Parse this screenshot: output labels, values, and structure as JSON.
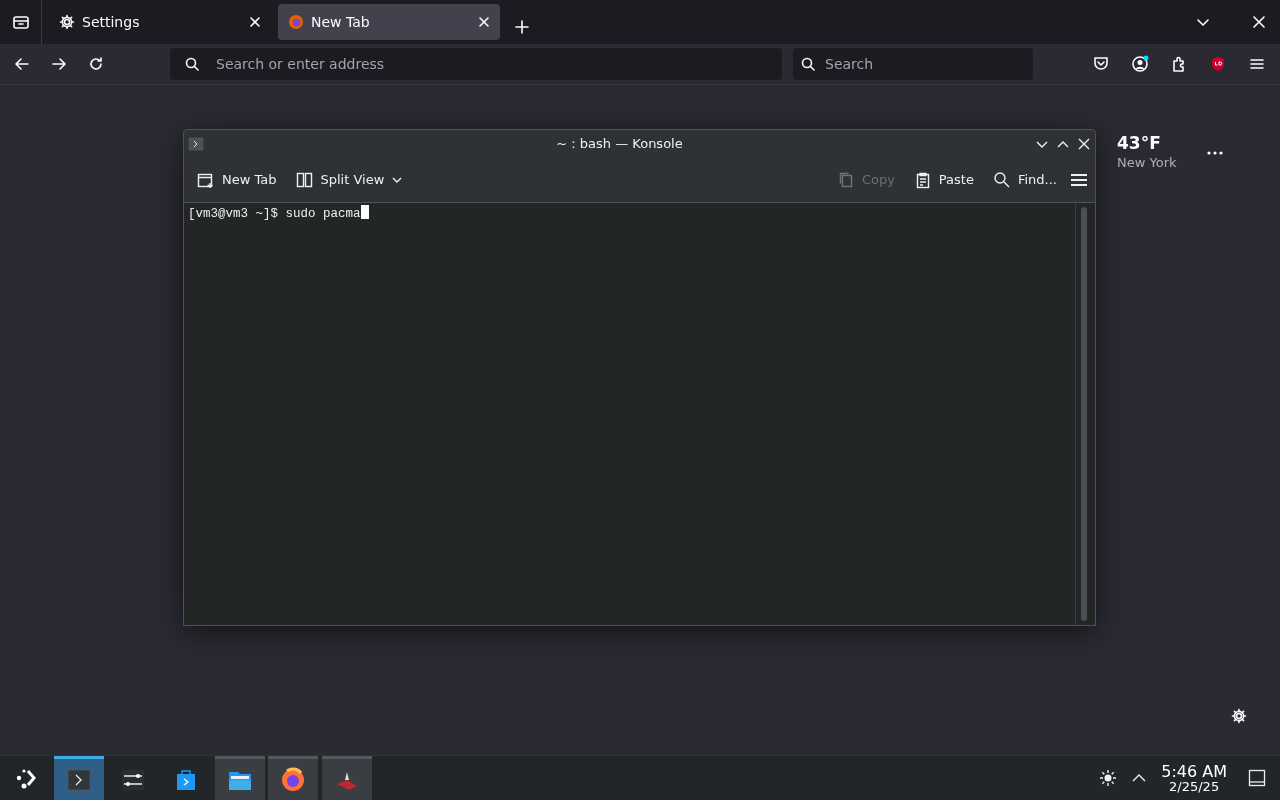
{
  "browser": {
    "tabs": [
      {
        "label": "Settings",
        "kind": "gear",
        "selected": false
      },
      {
        "label": "New Tab",
        "kind": "firefox",
        "selected": true
      }
    ],
    "address": {
      "placeholder": "Search or enter address"
    },
    "search": {
      "placeholder": "Search"
    },
    "toolbar_icons": [
      {
        "kind": "pocket",
        "badge": false
      },
      {
        "kind": "account",
        "badge": true
      },
      {
        "kind": "extensions",
        "badge": false
      },
      {
        "kind": "ublock",
        "badge": false
      },
      {
        "kind": "menu",
        "badge": false
      }
    ]
  },
  "new_tab": {
    "weather": {
      "temperature": "43°F",
      "city": "New York"
    }
  },
  "konsole": {
    "title": "~ : bash — Konsole",
    "toolbar": [
      {
        "kind": "new-tab",
        "label": "New Tab",
        "disabled": false
      },
      {
        "kind": "split-view",
        "label": "Split View",
        "disabled": false
      },
      {
        "kind": "copy",
        "label": "Copy",
        "disabled": true
      },
      {
        "kind": "paste",
        "label": "Paste",
        "disabled": false
      },
      {
        "kind": "find",
        "label": "Find...",
        "disabled": false
      }
    ],
    "terminal_line": "[vm3@vm3 ~]$ sudo pacma"
  },
  "taskbar": {
    "apps": [
      {
        "kind": "konsole",
        "selected": true,
        "running": true
      },
      {
        "kind": "settings",
        "selected": false,
        "running": false
      },
      {
        "kind": "store",
        "selected": false,
        "running": false
      },
      {
        "kind": "files",
        "selected": false,
        "running": true
      },
      {
        "kind": "firefox",
        "selected": false,
        "running": true
      },
      {
        "kind": "app",
        "selected": false,
        "running": true
      }
    ],
    "clock": {
      "time": "5:46 AM",
      "date": "2/25/25"
    }
  }
}
